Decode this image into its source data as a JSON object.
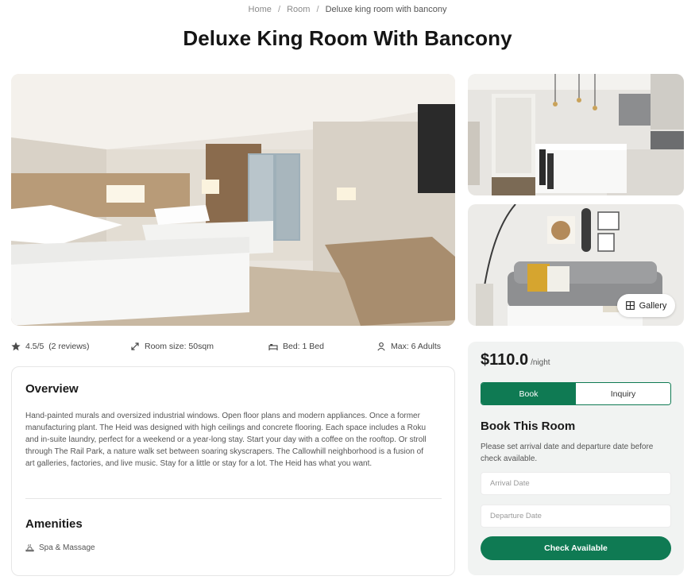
{
  "breadcrumb": {
    "items": [
      "Home",
      "Room",
      "Deluxe king room with bancony"
    ],
    "separator": "/"
  },
  "page_title": "Deluxe King Room With Bancony",
  "gallery_button": {
    "label": "Gallery",
    "icon": "grid-icon"
  },
  "meta": {
    "rating": {
      "icon": "star-icon",
      "label": "4.5/5  (2 reviews)"
    },
    "room_size": {
      "icon": "expand-arrows-icon",
      "label": "Room size: 50sqm"
    },
    "bed": {
      "icon": "bed-icon",
      "label": "Bed: 1 Bed"
    },
    "max": {
      "icon": "person-icon",
      "label": "Max: 6 Adults"
    }
  },
  "overview": {
    "title": "Overview",
    "text": "Hand-painted murals and oversized industrial windows. Open floor plans and modern appliances. Once a former manufacturing plant. The Heid was designed with high ceilings and concrete flooring. Each space includes a Roku and in-suite laundry, perfect for a weekend or a year-long stay. Start your day with a coffee on the rooftop. Or stroll through The Rail Park, a nature walk set between soaring skyscrapers. The Callowhill neighborhood is a fusion of art galleries, factories, and live music. Stay for a little or stay for a lot. The Heid has what you want."
  },
  "amenities": {
    "title": "Amenities",
    "items": [
      {
        "icon": "spa-icon",
        "label": "Spa & Massage"
      }
    ]
  },
  "booking": {
    "price": "$110.0",
    "unit": "/night",
    "tabs": [
      {
        "label": "Book",
        "active": true
      },
      {
        "label": "Inquiry",
        "active": false
      }
    ],
    "title": "Book This Room",
    "description": "Please set arrival date and departure date before check available.",
    "arrival_placeholder": "Arrival Date",
    "departure_placeholder": "Departure Date",
    "check_button": "Check Available"
  },
  "colors": {
    "accent": "#0f7a53",
    "card_bg": "#f1f3f2",
    "text_dark": "#1a1a1a",
    "text_muted": "#555555"
  }
}
